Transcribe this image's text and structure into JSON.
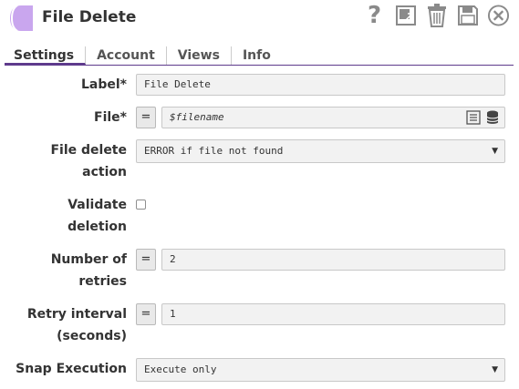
{
  "header": {
    "title": "File Delete",
    "icons": [
      "help-icon",
      "export-icon",
      "delete-icon",
      "save-icon",
      "close-icon"
    ]
  },
  "tabs": [
    {
      "label": "Settings",
      "active": true
    },
    {
      "label": "Account",
      "active": false
    },
    {
      "label": "Views",
      "active": false
    },
    {
      "label": "Info",
      "active": false
    }
  ],
  "form": {
    "label": {
      "label": "Label*",
      "value": "File Delete"
    },
    "file": {
      "label": "File*",
      "expr_toggle": "=",
      "value": "$filename"
    },
    "file_delete_action": {
      "label_line1": "File delete",
      "label_line2": "action",
      "value": "ERROR if file not found"
    },
    "validate_deletion": {
      "label_line1": "Validate",
      "label_line2": "deletion",
      "checked": false
    },
    "number_of_retries": {
      "label_line1": "Number of",
      "label_line2": "retries",
      "expr_toggle": "=",
      "value": "2"
    },
    "retry_interval": {
      "label_line1": "Retry interval",
      "label_line2": "(seconds)",
      "expr_toggle": "=",
      "value": "1"
    },
    "snap_execution": {
      "label": "Snap Execution",
      "value": "Execute only"
    }
  },
  "colors": {
    "accent": "#5e3a8c",
    "logo": "#c9a6ee",
    "field_bg": "#f2f2f2"
  }
}
